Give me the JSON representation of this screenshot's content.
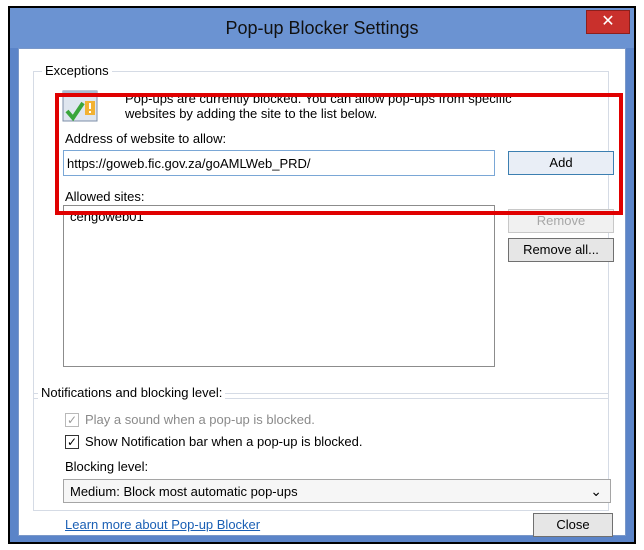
{
  "window": {
    "title": "Pop-up Blocker Settings"
  },
  "exceptions": {
    "legend": "Exceptions",
    "description_line1": "Pop-ups are currently blocked.  You can allow pop-ups from specific",
    "description_line2": "websites by adding the site to the list below.",
    "address_label": "Address of website to allow:",
    "address_value": "https://goweb.fic.gov.za/goAMLWeb_PRD/",
    "add_label": "Add",
    "allowed_label": "Allowed sites:",
    "allowed_sites": [
      "cengoweb01"
    ],
    "remove_label": "Remove",
    "remove_all_label": "Remove all..."
  },
  "notifications": {
    "legend": "Notifications and blocking level:",
    "play_sound_label": "Play a sound when a pop-up is blocked.",
    "show_bar_label": "Show Notification bar when a pop-up is blocked.",
    "blocking_level_label": "Blocking level:",
    "blocking_level_value": "Medium: Block most automatic pop-ups"
  },
  "footer": {
    "learn_more": "Learn more about Pop-up Blocker",
    "close_label": "Close"
  },
  "colors": {
    "accent": "#5b84c8",
    "highlight": "#e00000"
  }
}
